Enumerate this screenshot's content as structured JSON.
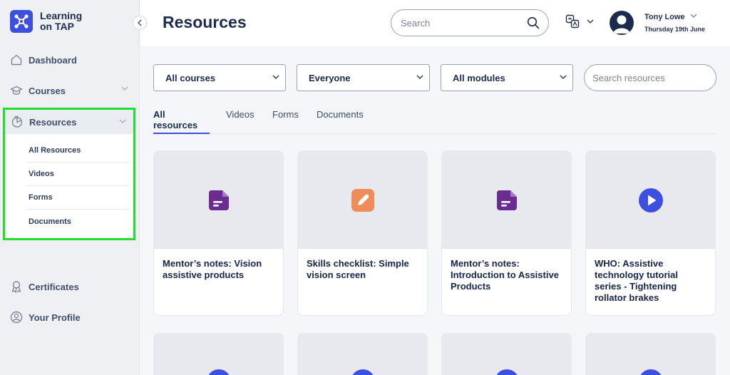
{
  "app": {
    "name": "Learning on TAP",
    "brand_color": "#3d4fe0"
  },
  "sidebar": {
    "items": [
      {
        "label": "Dashboard",
        "icon": "home-icon"
      },
      {
        "label": "Courses",
        "icon": "mortarboard-icon"
      },
      {
        "label": "Resources",
        "icon": "resources-icon",
        "expanded": true
      },
      {
        "label": "Certificates",
        "icon": "certificate-icon"
      },
      {
        "label": "Your Profile",
        "icon": "profile-icon"
      }
    ],
    "resources_sub": [
      "All Resources",
      "Videos",
      "Forms",
      "Documents"
    ]
  },
  "header": {
    "title": "Resources",
    "search_placeholder": "Search",
    "user": {
      "name": "Tony Lowe",
      "date": "Thursday 19th June"
    }
  },
  "filters": {
    "course": "All courses",
    "audience": "Everyone",
    "module": "All modules",
    "search_placeholder": "Search resources"
  },
  "tabs": [
    "All resources",
    "Videos",
    "Forms",
    "Documents"
  ],
  "cards": [
    {
      "title": "Mentor’s notes: Vision assistive products",
      "icon": "document-icon",
      "color": "#6b2c91"
    },
    {
      "title": "Skills checklist: Simple vision screen",
      "icon": "edit-form-icon",
      "color": "#f08c5a"
    },
    {
      "title": "Mentor’s notes: Introduction to Assistive Products",
      "icon": "document-icon",
      "color": "#6b2c91"
    },
    {
      "title": "WHO: Assistive technology tutorial series - Tightening rollator brakes",
      "icon": "play-icon",
      "color": "#3d4fe0"
    }
  ]
}
